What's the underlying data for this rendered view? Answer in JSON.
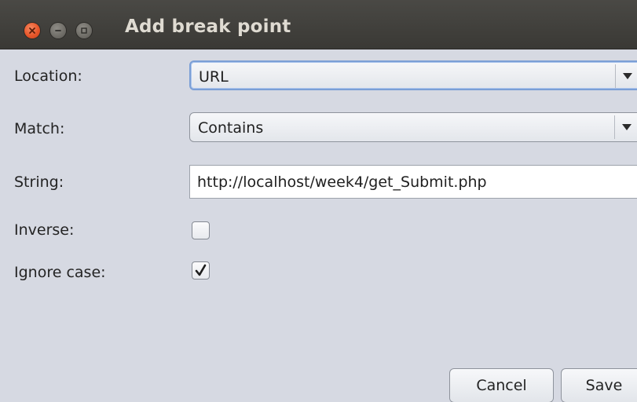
{
  "window": {
    "title": "Add break point"
  },
  "titlebar": {
    "close_icon": "close-icon",
    "minimize_icon": "minimize-icon",
    "maximize_icon": "maximize-icon",
    "colors": {
      "close": "#e8562a",
      "bar": "#3f3e3a"
    }
  },
  "form": {
    "location": {
      "label": "Location:",
      "value": "URL"
    },
    "match": {
      "label": "Match:",
      "value": "Contains"
    },
    "string": {
      "label": "String:",
      "value": "http://localhost/week4/get_Submit.php"
    },
    "inverse": {
      "label": "Inverse:",
      "checked": false
    },
    "ignore_case": {
      "label": "Ignore case:",
      "checked": true
    }
  },
  "buttons": {
    "cancel": "Cancel",
    "save": "Save"
  }
}
